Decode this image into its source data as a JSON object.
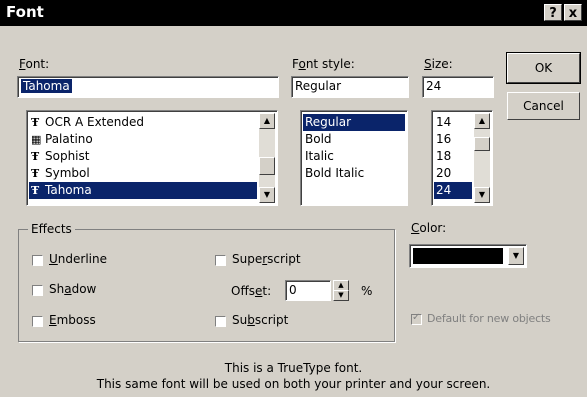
{
  "window": {
    "title": "Font",
    "help_label": "?",
    "close_label": "x"
  },
  "font": {
    "label_prefix": "",
    "label_accel": "F",
    "label_rest": "ont:",
    "value": "Tahoma",
    "items": [
      {
        "label": "OCR A Extended",
        "icon": "truetype-icon",
        "glyph": "Ŧ"
      },
      {
        "label": "Palatino",
        "icon": "printer-font-icon",
        "glyph": "▦"
      },
      {
        "label": "Sophist",
        "icon": "truetype-icon",
        "glyph": "Ŧ"
      },
      {
        "label": "Symbol",
        "icon": "truetype-icon",
        "glyph": "Ŧ"
      },
      {
        "label": "Tahoma",
        "icon": "truetype-icon",
        "glyph": "Ŧ"
      }
    ],
    "selected_index": 4
  },
  "style": {
    "label_prefix": "F",
    "label_accel": "o",
    "label_rest": "nt style:",
    "value": "Regular",
    "items": [
      "Regular",
      "Bold",
      "Italic",
      "Bold Italic"
    ],
    "selected_index": 0
  },
  "size": {
    "label_prefix": "",
    "label_accel": "S",
    "label_rest": "ize:",
    "value": "24",
    "items": [
      "14",
      "16",
      "18",
      "20",
      "24"
    ],
    "selected_index": 4
  },
  "buttons": {
    "ok": "OK",
    "cancel": "Cancel"
  },
  "effects": {
    "group_label": "Effects",
    "underline": {
      "prefix": "",
      "accel": "U",
      "rest": "nderline",
      "checked": false
    },
    "shadow": {
      "prefix": "Sh",
      "accel": "a",
      "rest": "dow",
      "checked": false
    },
    "emboss": {
      "prefix": "",
      "accel": "E",
      "rest": "mboss",
      "checked": false
    },
    "superscript": {
      "prefix": "Supe",
      "accel": "r",
      "rest": "script",
      "checked": false
    },
    "offset": {
      "prefix": "Offs",
      "accel": "e",
      "rest": "t:",
      "value": "0",
      "unit": "%"
    },
    "subscript": {
      "prefix": "Su",
      "accel": "b",
      "rest": "script",
      "checked": false
    }
  },
  "color": {
    "label_prefix": "",
    "label_accel": "C",
    "label_rest": "olor:",
    "swatch": "#000000",
    "default_label": "Default for new objects",
    "default_checked": true
  },
  "info": {
    "line1": "This is a TrueType font.",
    "line2": "This same font will be used on both your printer and your screen."
  },
  "colors": {
    "selection": "#0a246a",
    "face": "#d4d0c8",
    "titlebar": "#000000"
  }
}
